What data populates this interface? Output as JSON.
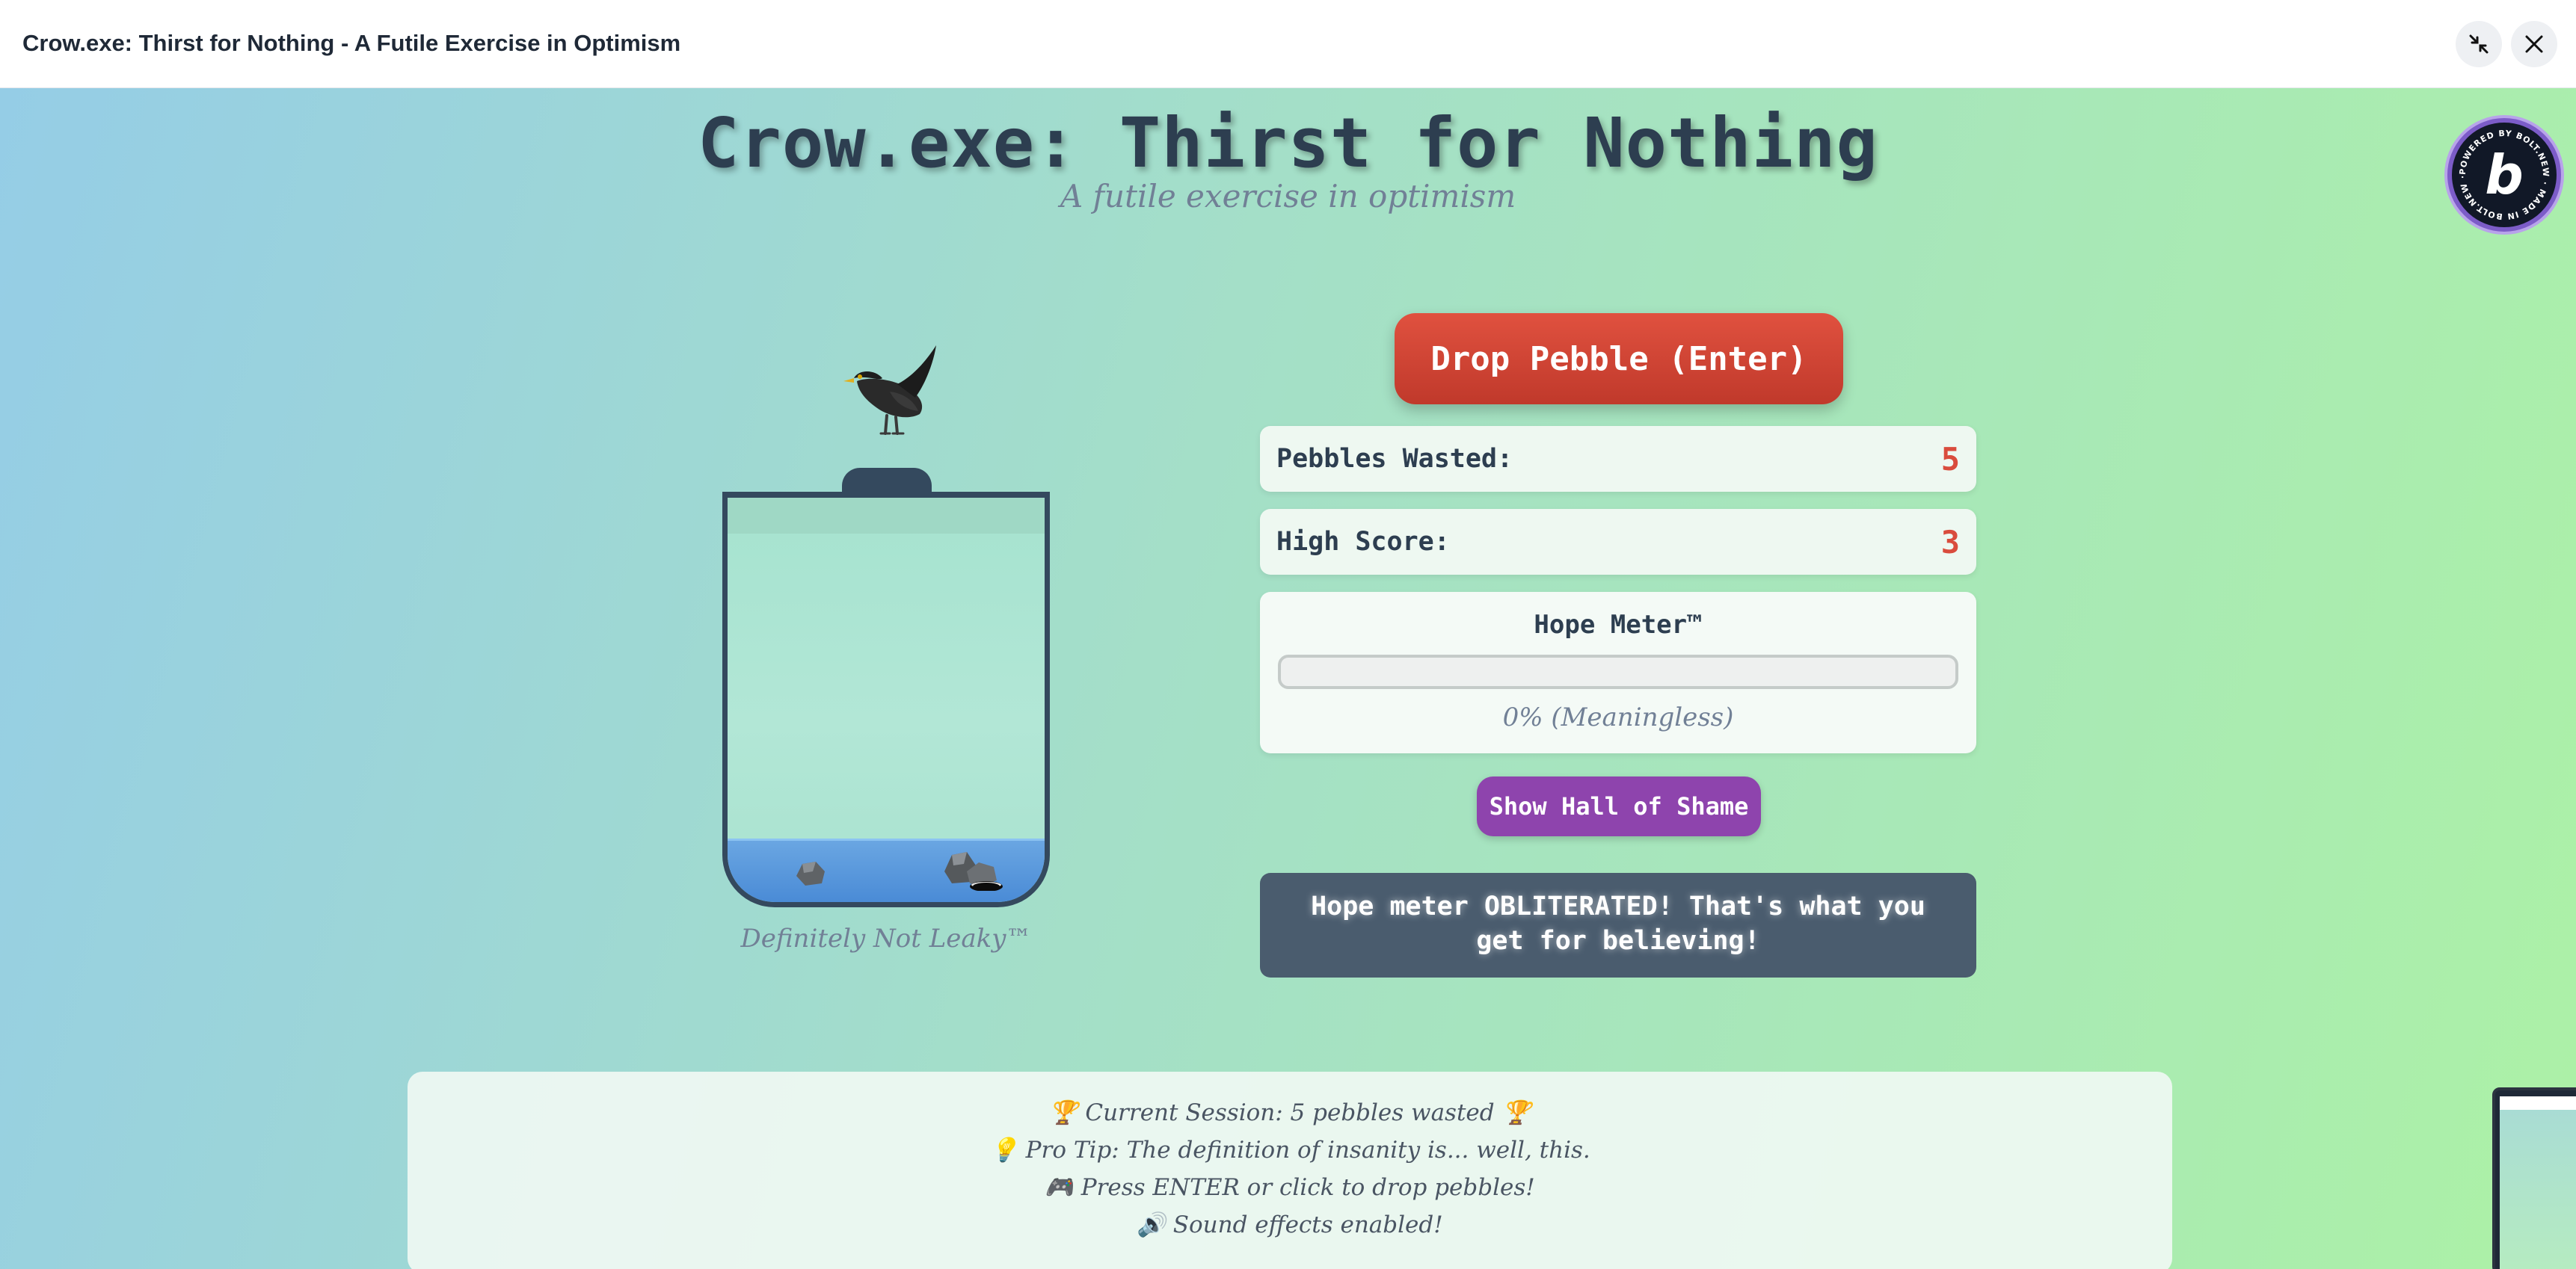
{
  "window": {
    "title": "Crow.exe: Thirst for Nothing - A Futile Exercise in Optimism"
  },
  "game": {
    "title": "Crow.exe: Thirst for Nothing",
    "subtitle": "A futile exercise in optimism"
  },
  "jar": {
    "label": "Definitely Not Leaky™"
  },
  "controls": {
    "drop_label": "Drop Pebble (Enter)",
    "shame_label": "Show Hall of Shame"
  },
  "stats": {
    "pebbles_label": "Pebbles Wasted:",
    "pebbles_value": "5",
    "high_score_label": "High Score:",
    "high_score_value": "3"
  },
  "hope": {
    "title": "Hope Meter™",
    "percent": 0,
    "text": "0% (Meaningless)"
  },
  "message": "Hope meter OBLITERATED! That's what you get for believing!",
  "footer": {
    "lines": [
      "🏆 Current Session: 5 pebbles wasted 🏆",
      "💡 Pro Tip: The definition of insanity is... well, this.",
      "🎮 Press ENTER or click to drop pebbles!",
      "🔊 Sound effects enabled!"
    ]
  },
  "badge": {
    "letter": "b",
    "ring_text": "POWERED BY BOLT.NEW · MADE IN BOLT.NEW ·"
  },
  "colors": {
    "accent_red": "#d94c3d",
    "button_purple": "#8e44ad",
    "jar_dark": "#34495e",
    "water_blue": "#4a8bd6"
  },
  "icons": {
    "minimize": "collapse-icon",
    "close": "close-icon"
  }
}
